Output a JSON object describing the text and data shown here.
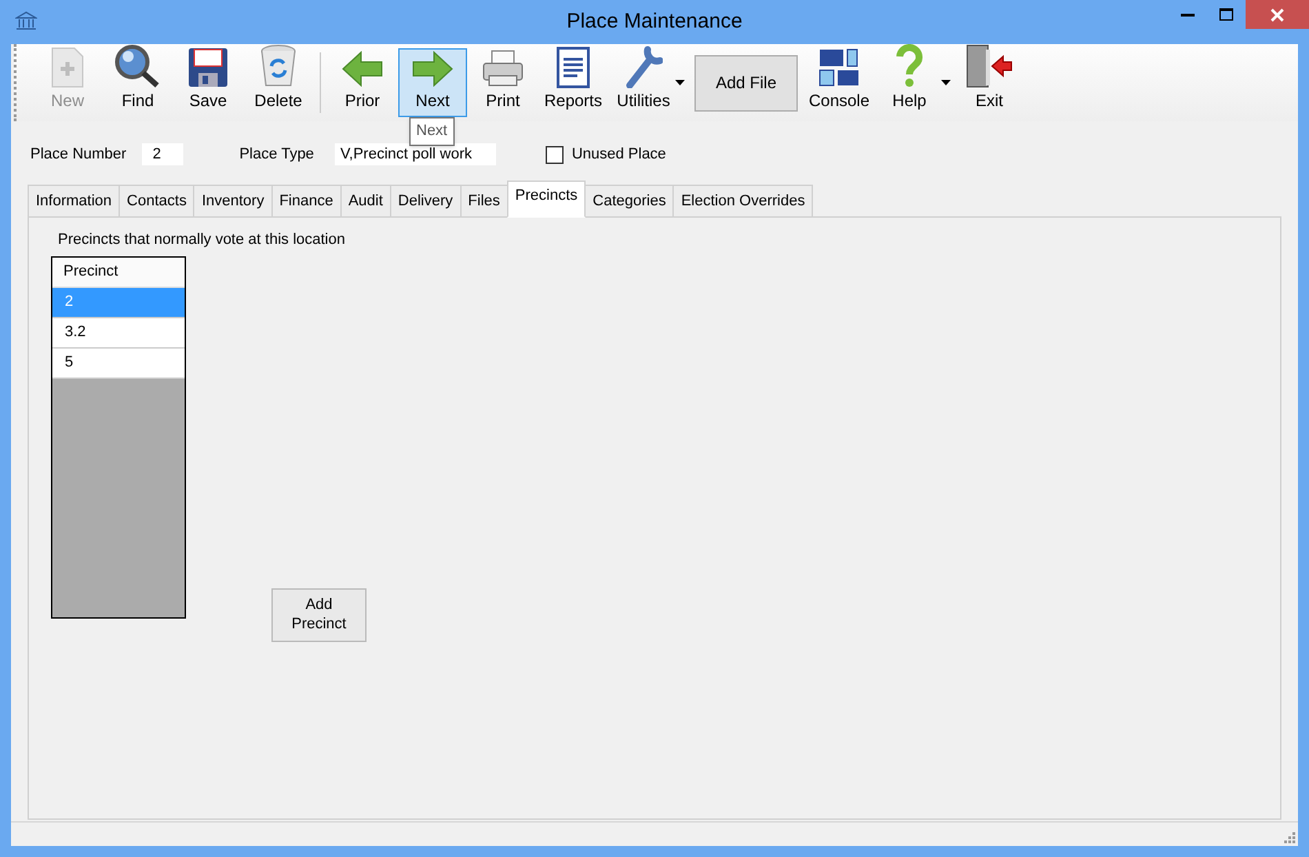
{
  "window": {
    "title": "Place Maintenance"
  },
  "toolbar": [
    {
      "kind": "tool",
      "label": "New",
      "disabled": true,
      "highlighted": false,
      "dropdown": false
    },
    {
      "kind": "tool",
      "label": "Find",
      "disabled": false,
      "highlighted": false,
      "dropdown": false
    },
    {
      "kind": "tool",
      "label": "Save",
      "disabled": false,
      "highlighted": false,
      "dropdown": false
    },
    {
      "kind": "tool",
      "label": "Delete",
      "disabled": false,
      "highlighted": false,
      "dropdown": false
    },
    {
      "kind": "separator"
    },
    {
      "kind": "tool",
      "label": "Prior",
      "disabled": false,
      "highlighted": false,
      "dropdown": false
    },
    {
      "kind": "tool",
      "label": "Next",
      "disabled": false,
      "highlighted": true,
      "dropdown": false
    },
    {
      "kind": "tool",
      "label": "Print",
      "disabled": false,
      "highlighted": false,
      "dropdown": false
    },
    {
      "kind": "tool",
      "label": "Reports",
      "disabled": false,
      "highlighted": false,
      "dropdown": false
    },
    {
      "kind": "tool",
      "label": "Utilities",
      "disabled": false,
      "highlighted": false,
      "dropdown": true
    },
    {
      "kind": "button",
      "label": "Add File"
    },
    {
      "kind": "tool",
      "label": "Console",
      "disabled": false,
      "highlighted": false,
      "dropdown": false
    },
    {
      "kind": "tool",
      "label": "Help",
      "disabled": false,
      "highlighted": false,
      "dropdown": true
    },
    {
      "kind": "tool",
      "label": "Exit",
      "disabled": false,
      "highlighted": false,
      "dropdown": false
    }
  ],
  "tooltip": "Next",
  "form": {
    "place_number_label": "Place Number",
    "place_number": "2",
    "place_type_label": "Place Type",
    "place_type": "V,Precinct poll work",
    "unused_place": {
      "label": "Unused Place",
      "checked": false
    }
  },
  "tabs": [
    {
      "label": "Information",
      "selected": false
    },
    {
      "label": "Contacts",
      "selected": false
    },
    {
      "label": "Inventory",
      "selected": false
    },
    {
      "label": "Finance",
      "selected": false
    },
    {
      "label": "Audit",
      "selected": false
    },
    {
      "label": "Delivery",
      "selected": false
    },
    {
      "label": "Files",
      "selected": false
    },
    {
      "label": "Precincts",
      "selected": true
    },
    {
      "label": "Categories",
      "selected": false
    },
    {
      "label": "Election Overrides",
      "selected": false
    }
  ],
  "precincts": {
    "caption": "Precincts that normally vote at this location",
    "column": "Precinct",
    "rows": [
      {
        "value": "2",
        "selected": true
      },
      {
        "value": "3.2",
        "selected": false
      },
      {
        "value": "5",
        "selected": false
      }
    ],
    "add_button": "Add\nPrecinct"
  }
}
